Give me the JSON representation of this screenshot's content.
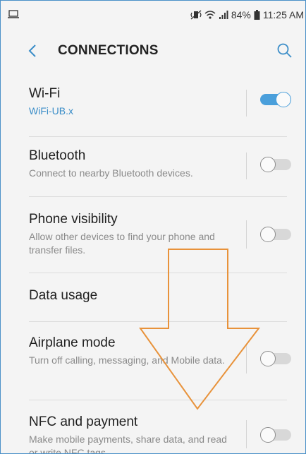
{
  "status_bar": {
    "battery": "84%",
    "time": "11:25 AM"
  },
  "header": {
    "title": "CONNECTIONS"
  },
  "icons": {
    "back": "chevron-left-icon",
    "search": "search-icon",
    "device": "laptop-icon",
    "mute": "vibrate-mute-icon",
    "wifi": "wifi-signal-icon",
    "cell": "cell-signal-icon",
    "battery": "battery-icon"
  },
  "colors": {
    "accent": "#4a9fdb",
    "annotation_arrow": "#e8923a"
  },
  "settings": [
    {
      "title": "Wi-Fi",
      "subtitle": "WiFi-UB.x",
      "toggle": true
    },
    {
      "title": "Bluetooth",
      "subtitle": "Connect to nearby Bluetooth devices.",
      "toggle": false
    },
    {
      "title": "Phone visibility",
      "subtitle": "Allow other devices to find your phone and transfer files.",
      "toggle": false
    },
    {
      "title": "Data usage",
      "subtitle": ""
    },
    {
      "title": "Airplane mode",
      "subtitle": "Turn off calling, messaging, and Mobile data.",
      "toggle": false
    },
    {
      "title": "NFC and payment",
      "subtitle": "Make mobile payments, share data, and read or write NFC tags.",
      "toggle": false
    }
  ]
}
